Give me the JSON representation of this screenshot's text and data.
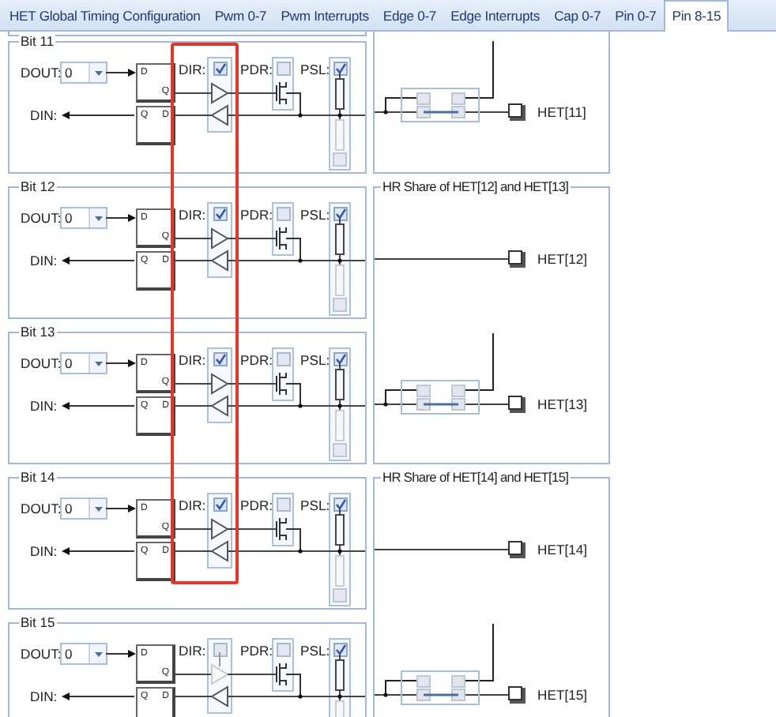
{
  "tabs": [
    {
      "label": "HET Global Timing Configuration",
      "selected": false
    },
    {
      "label": "Pwm 0-7",
      "selected": false
    },
    {
      "label": "Pwm Interrupts",
      "selected": false
    },
    {
      "label": "Edge 0-7",
      "selected": false
    },
    {
      "label": "Edge Interrupts",
      "selected": false
    },
    {
      "label": "Cap 0-7",
      "selected": false
    },
    {
      "label": "Pin 0-7",
      "selected": false
    },
    {
      "label": "Pin 8-15",
      "selected": true
    }
  ],
  "bits": [
    {
      "title": "Bit 11",
      "dout": {
        "label": "DOUT:",
        "value": "0"
      },
      "din": "DIN:",
      "flipflop": [
        "D",
        "Q",
        "Q",
        "D"
      ],
      "dir": {
        "label": "DIR:",
        "checked": true
      },
      "pdr": {
        "label": "PDR:",
        "checked": false
      },
      "psl": {
        "label": "PSL:",
        "checked": true
      }
    },
    {
      "title": "Bit 12",
      "dout": {
        "label": "DOUT:",
        "value": "0"
      },
      "din": "DIN:",
      "flipflop": [
        "D",
        "Q",
        "Q",
        "D"
      ],
      "dir": {
        "label": "DIR:",
        "checked": true
      },
      "pdr": {
        "label": "PDR:",
        "checked": false
      },
      "psl": {
        "label": "PSL:",
        "checked": true
      }
    },
    {
      "title": "Bit 13",
      "dout": {
        "label": "DOUT:",
        "value": "0"
      },
      "din": "DIN:",
      "flipflop": [
        "D",
        "Q",
        "Q",
        "D"
      ],
      "dir": {
        "label": "DIR:",
        "checked": true
      },
      "pdr": {
        "label": "PDR:",
        "checked": false
      },
      "psl": {
        "label": "PSL:",
        "checked": true
      }
    },
    {
      "title": "Bit 14",
      "dout": {
        "label": "DOUT:",
        "value": "0"
      },
      "din": "DIN:",
      "flipflop": [
        "D",
        "Q",
        "Q",
        "D"
      ],
      "dir": {
        "label": "DIR:",
        "checked": true
      },
      "pdr": {
        "label": "PDR:",
        "checked": false
      },
      "psl": {
        "label": "PSL:",
        "checked": true
      }
    },
    {
      "title": "Bit 15",
      "dout": {
        "label": "DOUT:",
        "value": "0"
      },
      "din": "DIN:",
      "flipflop": [
        "D",
        "Q",
        "Q",
        "D"
      ],
      "dir": {
        "label": "DIR:",
        "checked": false
      },
      "pdr": {
        "label": "PDR:",
        "checked": false
      },
      "psl": {
        "label": "PSL:",
        "checked": true
      }
    }
  ],
  "hr_shares": [
    {
      "pins": [
        {
          "label": "HET[11]",
          "kind": "shared"
        }
      ]
    },
    {
      "title": "HR Share of HET[12] and HET[13]",
      "pins": [
        {
          "label": "HET[12]",
          "kind": "direct"
        },
        {
          "label": "HET[13]",
          "kind": "shared"
        }
      ]
    },
    {
      "title": "HR Share of HET[14] and HET[15]",
      "pins": [
        {
          "label": "HET[14]",
          "kind": "direct"
        },
        {
          "label": "HET[15]",
          "kind": "shared"
        }
      ]
    }
  ]
}
